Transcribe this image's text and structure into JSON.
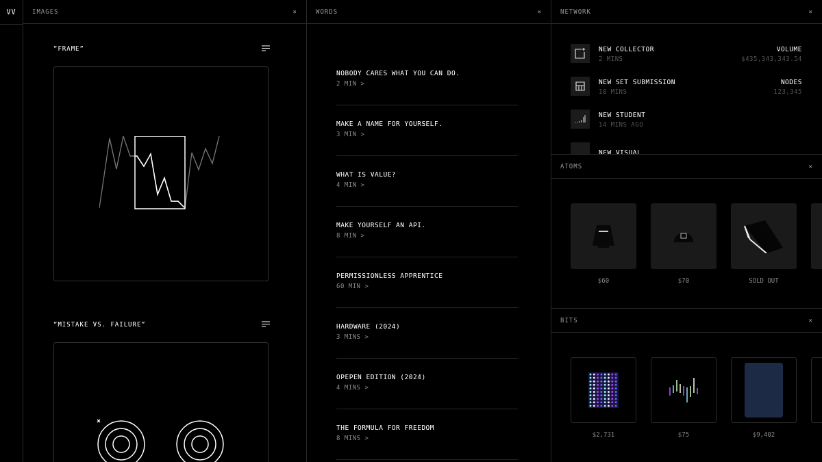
{
  "rail": {
    "logo": "VV"
  },
  "images": {
    "title": "IMAGES",
    "close": "×",
    "cards": [
      {
        "title": "“FRAME”",
        "kind": "chart"
      },
      {
        "title": "“MISTAKE VS. FAILURE”",
        "kind": "targets"
      }
    ]
  },
  "words": {
    "title": "WORDS",
    "close": "×",
    "articles": [
      {
        "title": "NOBODY CARES WHAT YOU CAN DO.",
        "duration": "2 MIN >"
      },
      {
        "title": "MAKE A NAME FOR YOURSELF.",
        "duration": "3 MIN >"
      },
      {
        "title": "WHAT IS VALUE?",
        "duration": "4 MIN >"
      },
      {
        "title": "MAKE YOURSELF AN API.",
        "duration": "8 MIN >"
      },
      {
        "title": "PERMISSIONLESS APPRENTICE",
        "duration": "60 MIN >"
      },
      {
        "title": "HARDWARE (2024)",
        "duration": "3 MINS >"
      },
      {
        "title": "OPEPEN EDITION (2024)",
        "duration": "4 MINS >"
      },
      {
        "title": "THE FORMULA FOR FREEDOM",
        "duration": "8 MINS >"
      }
    ]
  },
  "network": {
    "title": "NETWORK",
    "close": "×",
    "events": [
      {
        "kind": "collector",
        "title": "NEW COLLECTOR",
        "time": "2 MINS",
        "stat_label": "VOLUME",
        "stat_value": "$435,343,343.54"
      },
      {
        "kind": "submission",
        "title": "NEW SET SUBMISSION",
        "time": "10 MINS",
        "stat_label": "NODES",
        "stat_value": "123,345"
      },
      {
        "kind": "student",
        "title": "NEW STUDENT",
        "time": "14 MINS AGO"
      },
      {
        "kind": "visual",
        "title": "NEW VISUAL"
      }
    ]
  },
  "atoms": {
    "title": "ATOMS",
    "close": "×",
    "items": [
      {
        "kind": "sweater",
        "price": "$60"
      },
      {
        "kind": "cap",
        "price": "$70"
      },
      {
        "kind": "book",
        "price": "SOLD OUT"
      },
      {
        "kind": "blank"
      }
    ]
  },
  "bits": {
    "title": "BITS",
    "close": "×",
    "items": [
      {
        "kind": "dots",
        "price": "$2,731"
      },
      {
        "kind": "bars",
        "price": "$75"
      },
      {
        "kind": "illustration",
        "price": "$9,402"
      },
      {
        "kind": "blank"
      }
    ]
  }
}
